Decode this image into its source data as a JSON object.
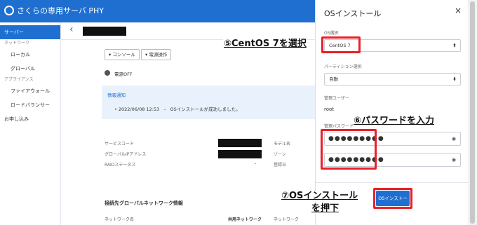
{
  "brand": {
    "name": "さくらの専用サーバ PHY"
  },
  "sidebar": {
    "items": [
      {
        "label": "サーバー"
      },
      {
        "label": "ネットワーク"
      },
      {
        "label": "ローカル"
      },
      {
        "label": "グローバル"
      },
      {
        "label": "アプライアンス"
      },
      {
        "label": "ファイアウォール"
      },
      {
        "label": "ロードバランサー"
      },
      {
        "label": "お申し込み"
      }
    ]
  },
  "main": {
    "console_button": "▾ コンソール",
    "power_button": "▾ 電源操作",
    "power_status": "電源OFF",
    "notice_title": "情報通知",
    "notice_text": "• 2022/06/08 12:53　-　OSインストールが成功しました。",
    "fields": {
      "service_code": "サービスコード",
      "global_ip": "グローバルIPアドレス",
      "raid_status": "RAIDステータス",
      "raid_value": "-",
      "model": "モデル名",
      "zone": "ゾーン",
      "registered": "登録日"
    },
    "network_section_title": "接続先グローバルネットワーク情報",
    "table_headers": [
      "ネットワーク名",
      "共用ネットワーク",
      "ネットワーク"
    ]
  },
  "panel": {
    "title": "OSインストール",
    "close": "×",
    "os_label": "OS選択",
    "os_value": "CentOS 7",
    "partition_label": "パーティション選択",
    "partition_value": "自動",
    "admin_user_label": "管理ユーザー",
    "admin_user_value": "root",
    "password_label": "管理パスワード",
    "password_mask": "●●●●●●●●●",
    "confirm_mask": "●●●●●●●●●",
    "install_button": "OSインストール"
  },
  "annotations": {
    "step5": "⑤CentOS 7を選択",
    "step6": "⑥パスワードを入力",
    "step7_line1": "⑦OSインストール",
    "step7_line2": "を押下",
    "highlight_color": "#e8202a"
  },
  "colors": {
    "accent": "#1f6fd1"
  }
}
